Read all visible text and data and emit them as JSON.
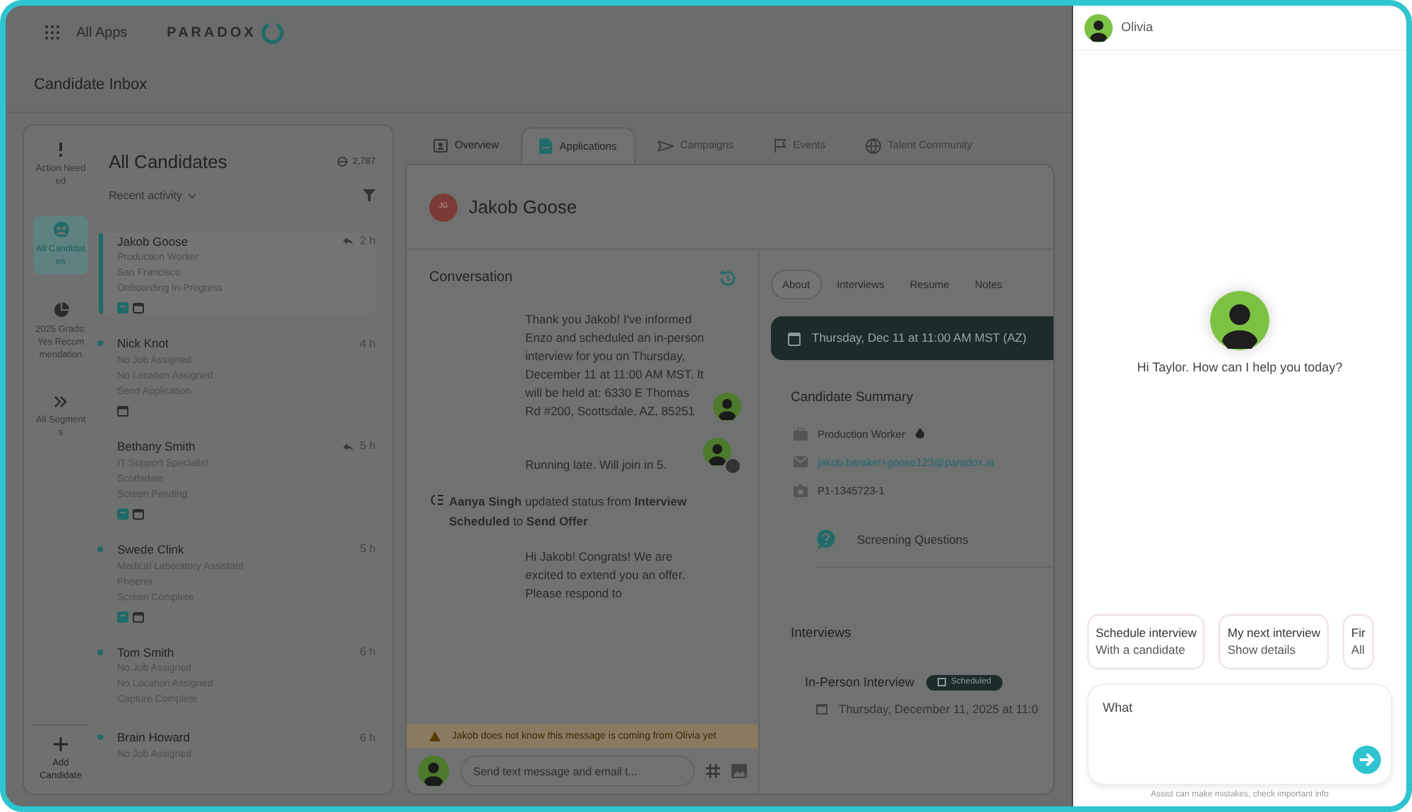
{
  "top_bar": {
    "apps_label": "All Apps",
    "brand": "PARADOX"
  },
  "page_title": "Candidate Inbox",
  "nav": [
    {
      "label": "Action Needed",
      "selected": false
    },
    {
      "label": "All Candidates",
      "selected": true
    },
    {
      "label": "2025 Grads: Yes Recommendation",
      "selected": false
    },
    {
      "label": "All Segments",
      "selected": false
    }
  ],
  "add_candidate": "Add Candidate",
  "list": {
    "title": "All Candidates",
    "count": "2,787",
    "sort": "Recent activity",
    "candidates": [
      {
        "name": "Jakob Goose",
        "lines": [
          "Production Worker",
          "San Francisco",
          "Onboarding In-Progress"
        ],
        "time": "2 h",
        "selected": true,
        "unread": false,
        "replied": true,
        "chat_icon": true,
        "calendar_icon": true
      },
      {
        "name": "Nick Knot",
        "lines": [
          "No Job Assigned",
          "No Location Assigned",
          "Send Application"
        ],
        "time": "4 h",
        "selected": false,
        "unread": true,
        "replied": false,
        "chat_icon": false,
        "calendar_icon": true
      },
      {
        "name": "Bethany Smith",
        "lines": [
          "IT Support Specialist",
          "Scottsdale",
          "Screen Pending"
        ],
        "time": "5 h",
        "selected": false,
        "unread": false,
        "replied": true,
        "chat_icon": true,
        "calendar_icon": true
      },
      {
        "name": "Swede Clink",
        "lines": [
          "Medical Laboratory Assistant",
          "Phoenix",
          "Screen Complete"
        ],
        "time": "5 h",
        "selected": false,
        "unread": true,
        "replied": false,
        "chat_icon": true,
        "calendar_icon": true
      },
      {
        "name": "Tom Smith",
        "lines": [
          "No Job Assigned",
          "No Location Assigned",
          "Capture Complete"
        ],
        "time": "6 h",
        "selected": false,
        "unread": true,
        "replied": false,
        "chat_icon": false,
        "calendar_icon": false
      },
      {
        "name": "Brain Howard",
        "lines": [
          "No Job Assigned"
        ],
        "time": "6 h",
        "selected": false,
        "unread": true,
        "replied": false,
        "chat_icon": false,
        "calendar_icon": false
      }
    ]
  },
  "tabs": [
    {
      "label": "Overview",
      "selected": false,
      "disabled": false
    },
    {
      "label": "Applications",
      "selected": true,
      "disabled": false
    },
    {
      "label": "Campaigns",
      "selected": false,
      "disabled": true
    },
    {
      "label": "Events",
      "selected": false,
      "disabled": true
    },
    {
      "label": "Talent Community",
      "selected": false,
      "disabled": true
    }
  ],
  "candidate": {
    "initials": "JG",
    "name": "Jakob Goose"
  },
  "conversation": {
    "title": "Conversation",
    "messages": [
      {
        "kind": "message",
        "text": "Thank you Jakob! I've informed Enzo and scheduled an in-person interview for you on Thursday, December 11 at 11:00 AM MST. It will be held at: 6330 E Thomas Rd #200, Scottsdale, AZ, 85251",
        "with_avatar": true,
        "group_avatar": false
      },
      {
        "kind": "message",
        "text": "Running late. Will join in 5.",
        "with_avatar": true,
        "group_avatar": true
      },
      {
        "kind": "status",
        "text": "**Aanya Singh** updated status from **Interview Scheduled** to **Send Offer**"
      },
      {
        "kind": "message",
        "text": "Hi Jakob! Congrats! We are excited to extend you an offer. Please respond to",
        "with_avatar": false,
        "group_avatar": false
      }
    ],
    "warning": "Jakob does not know this message is coming from Olivia yet",
    "composer_placeholder": "Send text message and email t..."
  },
  "details": {
    "tabs": [
      {
        "label": "About",
        "selected": true
      },
      {
        "label": "Interviews",
        "selected": false
      },
      {
        "label": "Resume",
        "selected": false
      },
      {
        "label": "Notes",
        "selected": false
      }
    ],
    "banner": "Thursday, Dec 11 at 11:00 AM MST (AZ)",
    "summary_title": "Candidate Summary",
    "summary": [
      {
        "kind": "job",
        "text": "Production Worker"
      },
      {
        "kind": "email",
        "text": "jakob.baraket+goose123@paradox.ai"
      },
      {
        "kind": "id",
        "text": "P1-1345723-1"
      }
    ],
    "screening": "Screening Questions",
    "interviews_title": "Interviews",
    "interview": {
      "title": "In-Person Interview",
      "status": "Scheduled",
      "date": "Thursday, December 11, 2025 at 11:0"
    }
  },
  "assistant": {
    "name": "Olivia",
    "greeting": "Hi Taylor. How can I help you today?",
    "suggestions": [
      {
        "title": "Schedule interview",
        "subtitle": "With a candidate"
      },
      {
        "title": "My next interview",
        "subtitle": "Show details"
      },
      {
        "title": "Fir",
        "subtitle": "All"
      }
    ],
    "input_value": "What",
    "disclaimer": "Assist can make mistakes, check important info"
  }
}
